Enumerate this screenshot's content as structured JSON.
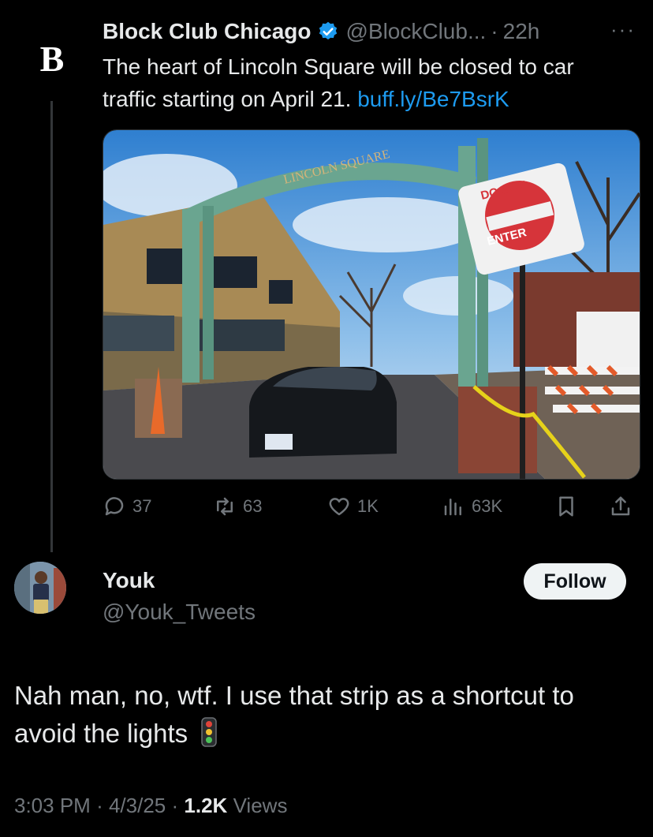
{
  "parent_tweet": {
    "avatar_letter": "B",
    "display_name": "Block Club Chicago",
    "handle": "@BlockClub...",
    "separator": "·",
    "time": "22h",
    "more": "···",
    "text": "The heart of Lincoln Square will be closed to car traffic starting on April 21.",
    "link_text": "buff.ly/Be7BsrK",
    "image": {
      "arch_text": "LINCOLN SQUARE",
      "sign_top": "DO NOT",
      "sign_bottom": "ENTER"
    },
    "stats": {
      "replies": "37",
      "reposts": "63",
      "likes": "1K",
      "views": "63K"
    }
  },
  "reply_tweet": {
    "display_name": "Youk",
    "handle": "@Youk_Tweets",
    "follow_label": "Follow",
    "text": "Nah man, no, wtf. I use that strip as a shortcut to avoid the lights",
    "emoji_name": "traffic-light-icon",
    "time": "3:03 PM",
    "date": "4/3/25",
    "views_count": "1.2K",
    "views_label": "Views",
    "separator": "·"
  },
  "colors": {
    "background": "#000000",
    "primary_text": "#e7e9ea",
    "secondary_text": "#71767b",
    "link": "#1d9bf0",
    "verified": "#1d9bf0"
  }
}
